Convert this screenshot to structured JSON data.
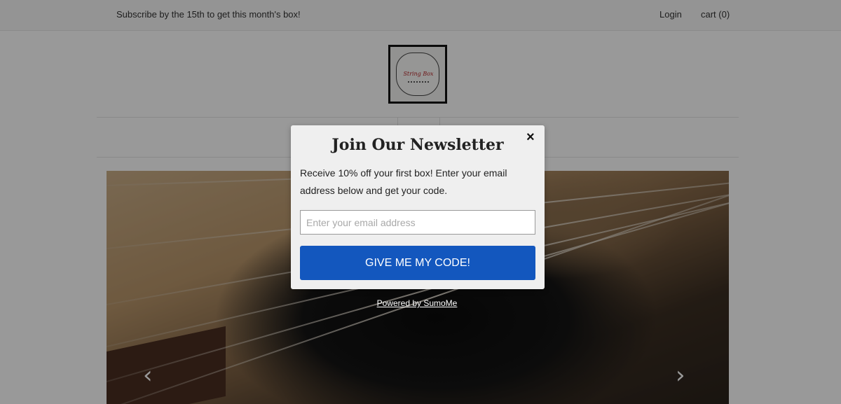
{
  "topbar": {
    "promo": "Subscribe by the 15th to get this month's box!",
    "login": "Login",
    "cart": "cart (0)"
  },
  "logo": {
    "brand": "String Box",
    "icon": "stringbox-logo"
  },
  "hero": {
    "prev_icon": "chevron-left-icon",
    "next_icon": "chevron-right-icon",
    "prev_glyph": "‹",
    "next_glyph": "›"
  },
  "modal": {
    "title": "Join Our Newsletter",
    "close": "×",
    "description": "Receive 10% off your first box! Enter your email address below and get your code.",
    "email_placeholder": "Enter your email address",
    "email_value": "",
    "cta": "GIVE ME MY CODE!",
    "cta_color": "#1357be"
  },
  "powered_by": "Powered by SumoMe"
}
